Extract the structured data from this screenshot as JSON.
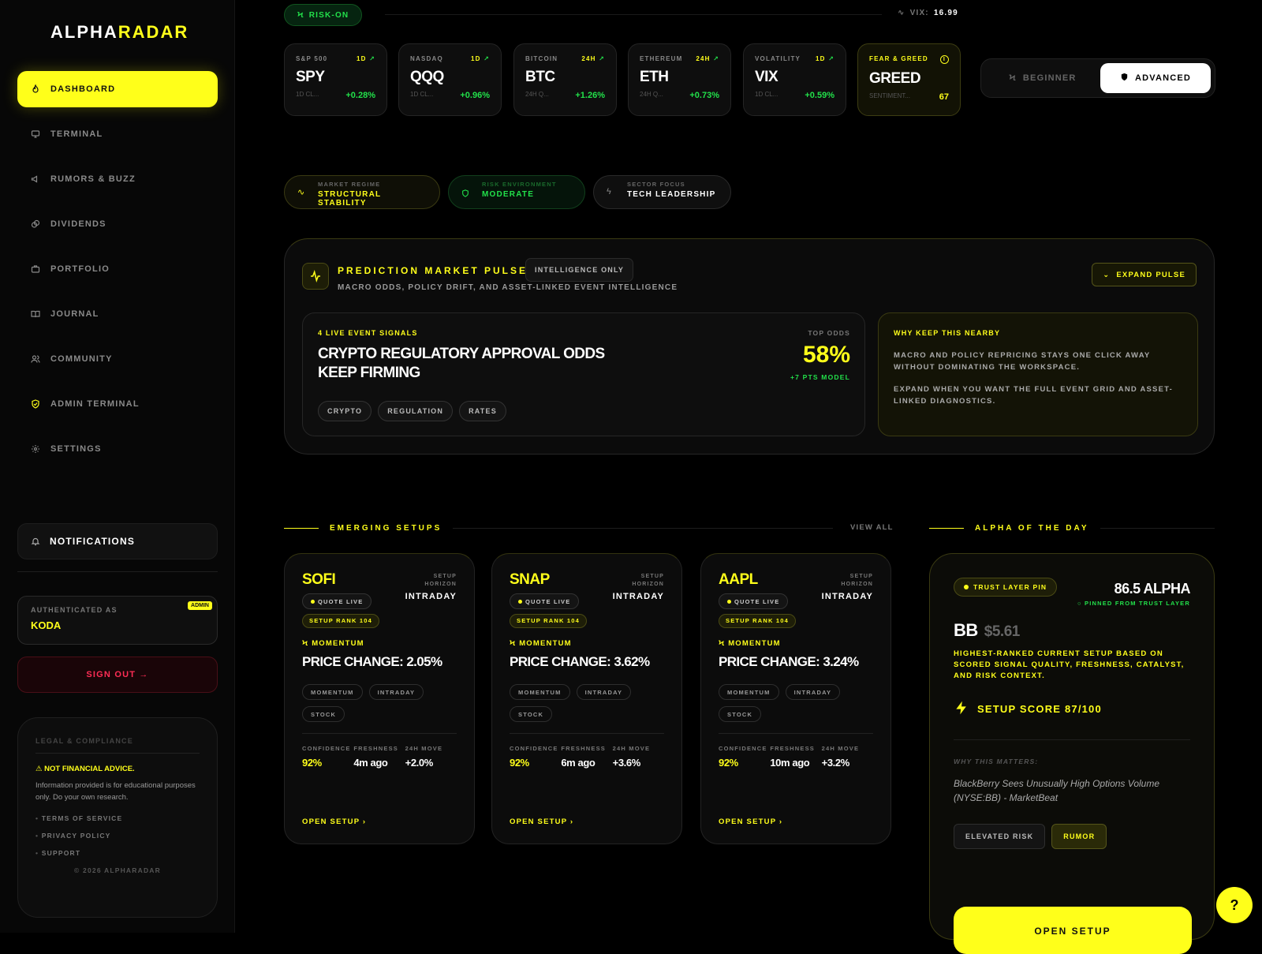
{
  "brand": {
    "part1": "ALPHA",
    "part2": "RADAR"
  },
  "sidebar": {
    "items": [
      {
        "label": "Dashboard",
        "icon": "flame-icon"
      },
      {
        "label": "Terminal",
        "icon": "monitor-icon"
      },
      {
        "label": "Rumors & Buzz",
        "icon": "megaphone-icon"
      },
      {
        "label": "Dividends",
        "icon": "coins-icon"
      },
      {
        "label": "Portfolio",
        "icon": "briefcase-icon"
      },
      {
        "label": "Journal",
        "icon": "book-icon"
      },
      {
        "label": "Community",
        "icon": "users-icon"
      },
      {
        "label": "Admin Terminal",
        "icon": "shield-check-icon"
      },
      {
        "label": "Settings",
        "icon": "gear-icon"
      }
    ],
    "notifications": "Notifications",
    "auth": {
      "label": "Authenticated as",
      "name": "KODA",
      "badge": "ADMIN"
    },
    "sign_out": "Sign Out →",
    "legal": {
      "heading": "Legal & Compliance",
      "warning": "NOT FINANCIAL ADVICE.",
      "text": "Information provided is for educational purposes only. Do your own research.",
      "links": [
        "Terms of Service",
        "Privacy Policy",
        "Support"
      ],
      "copyright": "© 2026 AlphaRadar"
    }
  },
  "status": {
    "risk": "RISK-ON",
    "vix_label": "VIX:",
    "vix_value": "16.99"
  },
  "tickers": [
    {
      "source": "S&P 500",
      "tf": "1D",
      "symbol": "SPY",
      "sub": "1D CL...",
      "change": "+0.28%"
    },
    {
      "source": "NASDAQ",
      "tf": "1D",
      "symbol": "QQQ",
      "sub": "1D CL...",
      "change": "+0.96%"
    },
    {
      "source": "BITCOIN",
      "tf": "24H",
      "symbol": "BTC",
      "sub": "24H Q...",
      "change": "+1.26%"
    },
    {
      "source": "ETHEREUM",
      "tf": "24H",
      "symbol": "ETH",
      "sub": "24H Q...",
      "change": "+0.73%"
    },
    {
      "source": "VOLATILITY",
      "tf": "1D",
      "symbol": "VIX",
      "sub": "1D CL...",
      "change": "+0.59%"
    },
    {
      "source": "FEAR & GREED",
      "tf": "",
      "symbol": "GREED",
      "sub": "SENTIMENT...",
      "change": "67"
    }
  ],
  "mode": {
    "beginner": "Beginner",
    "advanced": "Advanced"
  },
  "regime": [
    {
      "key": "Market Regime",
      "value": "Structural Stability"
    },
    {
      "key": "Risk Environment",
      "value": "Moderate"
    },
    {
      "key": "Sector Focus",
      "value": "Tech Leadership"
    }
  ],
  "pulse": {
    "title": "PREDICTION MARKET PULSE",
    "badge": "INTELLIGENCE ONLY",
    "subtitle": "MACRO ODDS, POLICY DRIFT, AND ASSET-LINKED EVENT INTELLIGENCE",
    "expand": "EXPAND PULSE",
    "signal": {
      "kicker": "4 LIVE EVENT SIGNALS",
      "title": "CRYPTO REGULATORY APPROVAL ODDS KEEP FIRMING",
      "odds_label": "TOP ODDS",
      "odds": "58%",
      "odds_note": "+7 PTS MODEL",
      "tags": [
        "CRYPTO",
        "REGULATION",
        "RATES"
      ]
    },
    "why": {
      "kicker": "WHY KEEP THIS NEARBY",
      "p1": "MACRO AND POLICY REPRICING STAYS ONE CLICK AWAY WITHOUT DOMINATING THE WORKSPACE.",
      "p2": "EXPAND WHEN YOU WANT THE FULL EVENT GRID AND ASSET-LINKED DIAGNOSTICS."
    }
  },
  "setups": {
    "title": "EMERGING SETUPS",
    "view_all": "VIEW ALL",
    "horizon_label": "SETUP HORIZON",
    "stat_labels": [
      "CONFIDENCE",
      "FRESHNESS",
      "24H MOVE"
    ],
    "cards": [
      {
        "symbol": "SOFI",
        "horizon": "INTRADAY",
        "quote": "QUOTE LIVE",
        "rank": "SETUP RANK 104",
        "signal": "MOMENTUM",
        "price": "PRICE CHANGE: 2.05%",
        "tags": [
          "MOMENTUM",
          "INTRADAY",
          "STOCK"
        ],
        "confidence": "92%",
        "freshness": "4m ago",
        "move": "+2.0%",
        "open": "OPEN SETUP ›"
      },
      {
        "symbol": "SNAP",
        "horizon": "INTRADAY",
        "quote": "QUOTE LIVE",
        "rank": "SETUP RANK 104",
        "signal": "MOMENTUM",
        "price": "PRICE CHANGE: 3.62%",
        "tags": [
          "MOMENTUM",
          "INTRADAY",
          "STOCK"
        ],
        "confidence": "92%",
        "freshness": "6m ago",
        "move": "+3.6%",
        "open": "OPEN SETUP ›"
      },
      {
        "symbol": "AAPL",
        "horizon": "INTRADAY",
        "quote": "QUOTE LIVE",
        "rank": "SETUP RANK 104",
        "signal": "MOMENTUM",
        "price": "PRICE CHANGE: 3.24%",
        "tags": [
          "MOMENTUM",
          "INTRADAY",
          "STOCK"
        ],
        "confidence": "92%",
        "freshness": "10m ago",
        "move": "+3.2%",
        "open": "OPEN SETUP ›"
      }
    ]
  },
  "alpha": {
    "title": "ALPHA OF THE DAY",
    "pin": "TRUST LAYER PIN",
    "score": "86.5 ALPHA",
    "pinned": "PINNED FROM TRUST LAYER",
    "symbol": "BB",
    "price": "$5.61",
    "desc": "HIGHEST-RANKED CURRENT SETUP BASED ON SCORED SIGNAL QUALITY, FRESHNESS, CATALYST, AND RISK CONTEXT.",
    "setup_score": "SETUP SCORE 87/100",
    "why_label": "WHY THIS MATTERS:",
    "quote": "BlackBerry Sees Unusually High Options Volume (NYSE:BB) - MarketBeat",
    "tags": [
      "ELEVATED RISK",
      "RUMOR"
    ],
    "button": "OPEN SETUP"
  },
  "help": "?"
}
